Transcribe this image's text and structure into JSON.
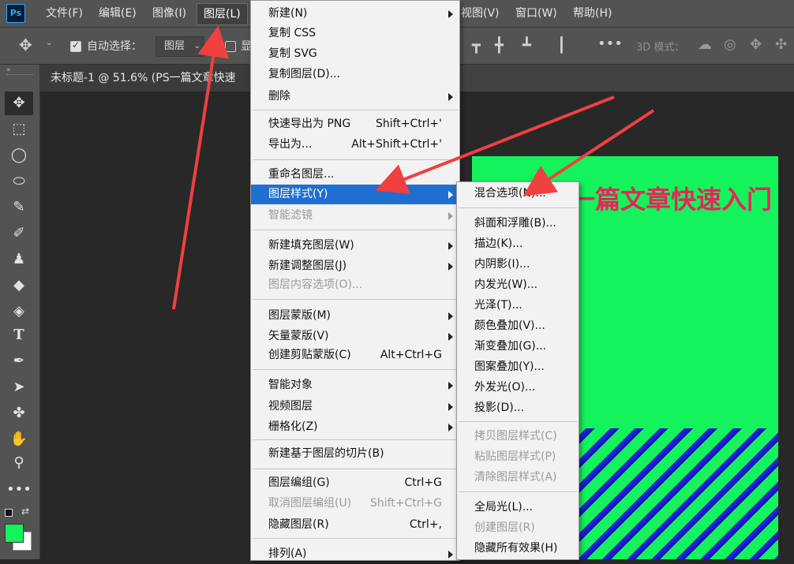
{
  "menubar": {
    "logo": "Ps",
    "items": [
      "文件(F)",
      "编辑(E)",
      "图像(I)",
      "图层(L)",
      "视图(V)",
      "窗口(W)",
      "帮助(H)"
    ]
  },
  "options": {
    "auto_select_label": "自动选择：",
    "auto_select_value": "图层",
    "show_label": "显",
    "mode_3d_label": "3D 模式："
  },
  "document": {
    "tab_title": "未标题-1 @ 51.6% (PS一篇文章快速",
    "canvas_title": "一篇文章快速入门"
  },
  "layer_menu": {
    "items": [
      {
        "label": "新建(N)",
        "shortcut": "",
        "submenu": true,
        "disabled": false
      },
      {
        "label": "复制 CSS",
        "shortcut": "",
        "submenu": false,
        "disabled": false
      },
      {
        "label": "复制 SVG",
        "shortcut": "",
        "submenu": false,
        "disabled": false
      },
      {
        "label": "复制图层(D)...",
        "shortcut": "",
        "submenu": false,
        "disabled": false
      },
      {
        "label": "删除",
        "shortcut": "",
        "submenu": true,
        "disabled": false
      },
      {
        "label": "快速导出为 PNG",
        "shortcut": "Shift+Ctrl+'",
        "submenu": false,
        "disabled": false
      },
      {
        "label": "导出为...",
        "shortcut": "Alt+Shift+Ctrl+'",
        "submenu": false,
        "disabled": false
      },
      {
        "label": "重命名图层...",
        "shortcut": "",
        "submenu": false,
        "disabled": false
      },
      {
        "label": "图层样式(Y)",
        "shortcut": "",
        "submenu": true,
        "disabled": false
      },
      {
        "label": "智能滤镜",
        "shortcut": "",
        "submenu": true,
        "disabled": true
      },
      {
        "label": "新建填充图层(W)",
        "shortcut": "",
        "submenu": true,
        "disabled": false
      },
      {
        "label": "新建调整图层(J)",
        "shortcut": "",
        "submenu": true,
        "disabled": false
      },
      {
        "label": "图层内容选项(O)...",
        "shortcut": "",
        "submenu": false,
        "disabled": true
      },
      {
        "label": "图层蒙版(M)",
        "shortcut": "",
        "submenu": true,
        "disabled": false
      },
      {
        "label": "矢量蒙版(V)",
        "shortcut": "",
        "submenu": true,
        "disabled": false
      },
      {
        "label": "创建剪贴蒙版(C)",
        "shortcut": "Alt+Ctrl+G",
        "submenu": false,
        "disabled": false
      },
      {
        "label": "智能对象",
        "shortcut": "",
        "submenu": true,
        "disabled": false
      },
      {
        "label": "视频图层",
        "shortcut": "",
        "submenu": true,
        "disabled": false
      },
      {
        "label": "栅格化(Z)",
        "shortcut": "",
        "submenu": true,
        "disabled": false
      },
      {
        "label": "新建基于图层的切片(B)",
        "shortcut": "",
        "submenu": false,
        "disabled": false
      },
      {
        "label": "图层编组(G)",
        "shortcut": "Ctrl+G",
        "submenu": false,
        "disabled": false
      },
      {
        "label": "取消图层编组(U)",
        "shortcut": "Shift+Ctrl+G",
        "submenu": false,
        "disabled": true
      },
      {
        "label": "隐藏图层(R)",
        "shortcut": "Ctrl+,",
        "submenu": false,
        "disabled": false
      },
      {
        "label": "排列(A)",
        "shortcut": "",
        "submenu": true,
        "disabled": false
      }
    ]
  },
  "style_menu": {
    "items": [
      {
        "label": "混合选项(N)...",
        "disabled": false
      },
      {
        "label": "斜面和浮雕(B)...",
        "disabled": false
      },
      {
        "label": "描边(K)...",
        "disabled": false
      },
      {
        "label": "内阴影(I)...",
        "disabled": false
      },
      {
        "label": "内发光(W)...",
        "disabled": false
      },
      {
        "label": "光泽(T)...",
        "disabled": false
      },
      {
        "label": "颜色叠加(V)...",
        "disabled": false
      },
      {
        "label": "渐变叠加(G)...",
        "disabled": false
      },
      {
        "label": "图案叠加(Y)...",
        "disabled": false
      },
      {
        "label": "外发光(O)...",
        "disabled": false
      },
      {
        "label": "投影(D)...",
        "disabled": false
      },
      {
        "label": "拷贝图层样式(C)",
        "disabled": true
      },
      {
        "label": "粘贴图层样式(P)",
        "disabled": true
      },
      {
        "label": "清除图层样式(A)",
        "disabled": true
      },
      {
        "label": "全局光(L)...",
        "disabled": false
      },
      {
        "label": "创建图层(R)",
        "disabled": true
      },
      {
        "label": "隐藏所有效果(H)",
        "disabled": false
      }
    ]
  },
  "colors": {
    "foreground": "#14f35c",
    "background": "#ffffff",
    "highlight": "#1f6fd1",
    "annotation": "#f04040"
  }
}
